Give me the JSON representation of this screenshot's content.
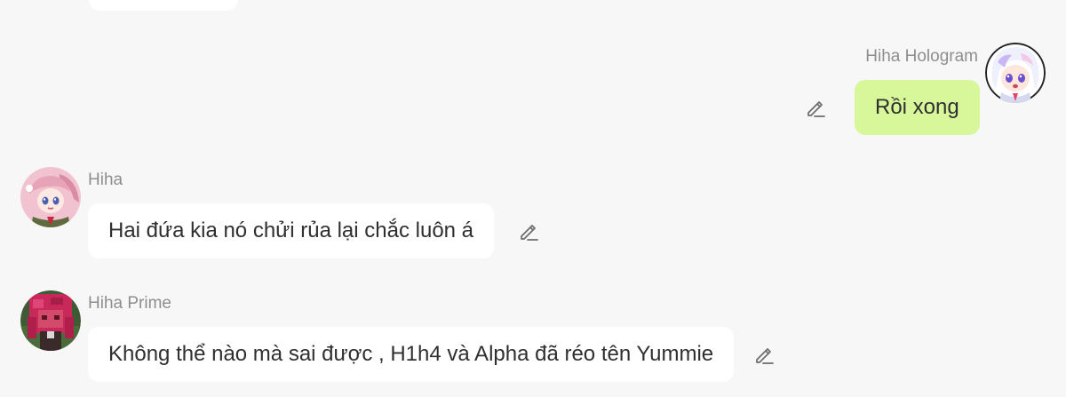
{
  "messages": [
    {
      "sender": "Hiha Hologram",
      "text": "Rồi xong",
      "own": true,
      "avatar_icon": "anime-character-avatar-white-hair",
      "action_icon": "pencil-edit-icon"
    },
    {
      "sender": "Hiha",
      "text": "Hai đứa kia nó chửi rủa lại chắc luôn á",
      "own": false,
      "avatar_icon": "anime-character-avatar-pink-hair",
      "action_icon": "pencil-edit-icon"
    },
    {
      "sender": "Hiha Prime",
      "text": "Không thể nào mà sai được , H1h4 và Alpha đã réo tên Yummie",
      "own": false,
      "avatar_icon": "pixel-character-avatar-red-hair",
      "action_icon": "pencil-edit-icon"
    }
  ],
  "colors": {
    "background": "#f7f7f7",
    "own_bubble": "#d8f79a",
    "other_bubble": "#ffffff",
    "sender_name": "#8e8e8e",
    "message_text": "#2f2f2f"
  }
}
